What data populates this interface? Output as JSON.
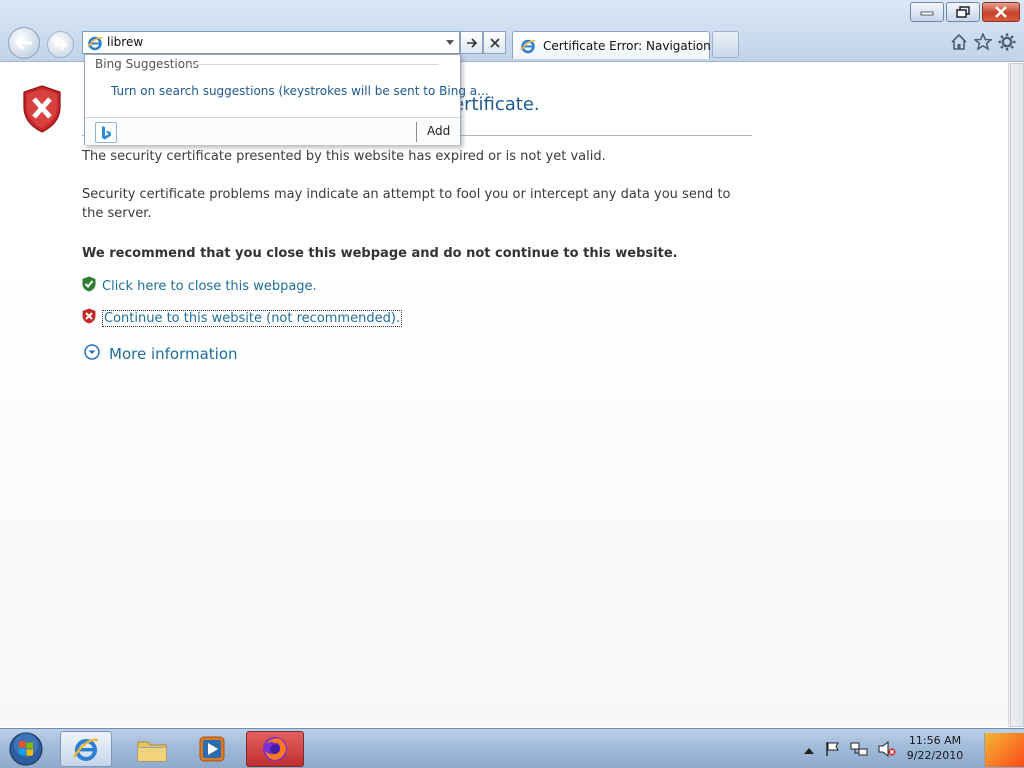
{
  "window": {
    "controls": [
      "minimize",
      "restore",
      "close"
    ]
  },
  "address_bar": {
    "value": "librew",
    "icons": [
      "ie-icon",
      "dropdown-caret-icon",
      "go-arrow-icon",
      "stop-x-icon"
    ]
  },
  "tab": {
    "label": "Certificate Error: Navigation ..."
  },
  "toolbar_icons": [
    "home-icon",
    "favorites-star-icon",
    "tools-gear-icon"
  ],
  "dropdown": {
    "header": "Bing Suggestions",
    "item": "Turn on search suggestions (keystrokes will be sent to Bing a...",
    "add_label": "Add"
  },
  "page": {
    "title_fragment": "ertificate.",
    "para1": "The security certificate presented by this website has expired or is not yet valid.",
    "para2": "Security certificate problems may indicate an attempt to fool you or intercept any data you send to the server.",
    "recommend": "We recommend that you close this webpage and do not continue to this website.",
    "close_link": "Click here to close this webpage.",
    "continue_link": "Continue to this website (not recommended).",
    "more_info": "More information"
  },
  "taskbar": {
    "items": [
      "internet-explorer",
      "windows-explorer",
      "media-player",
      "firefox"
    ],
    "time": "11:56 AM",
    "date": "9/22/2010"
  },
  "colors": {
    "link": "#1f6f9a",
    "title": "#1f5a8e",
    "error_red": "#c62828",
    "ok_green": "#2e7d32"
  }
}
